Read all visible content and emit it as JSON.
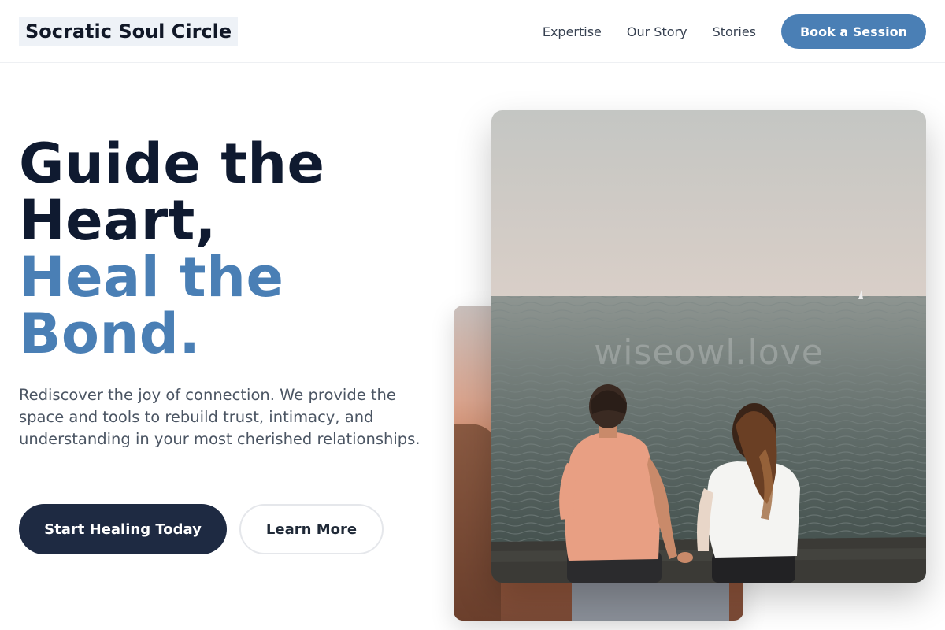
{
  "header": {
    "logo": "Socratic Soul Circle",
    "nav": [
      "Expertise",
      "Our Story",
      "Stories"
    ],
    "cta": "Book a Session"
  },
  "hero": {
    "title_line1": "Guide the",
    "title_line2": "Heart,",
    "title_line3": "Heal the",
    "title_line4": "Bond.",
    "description": "Rediscover the joy of connection. We provide the space and tools to rebuild trust, intimacy, and understanding in your most cherished relationships.",
    "primary_button": "Start Healing Today",
    "secondary_button": "Learn More"
  },
  "images": {
    "main_watermark": "wiseowl.love"
  },
  "colors": {
    "accent": "#4a7fb5",
    "dark": "#0f1a30",
    "primary_button_bg": "#1e2a42"
  }
}
